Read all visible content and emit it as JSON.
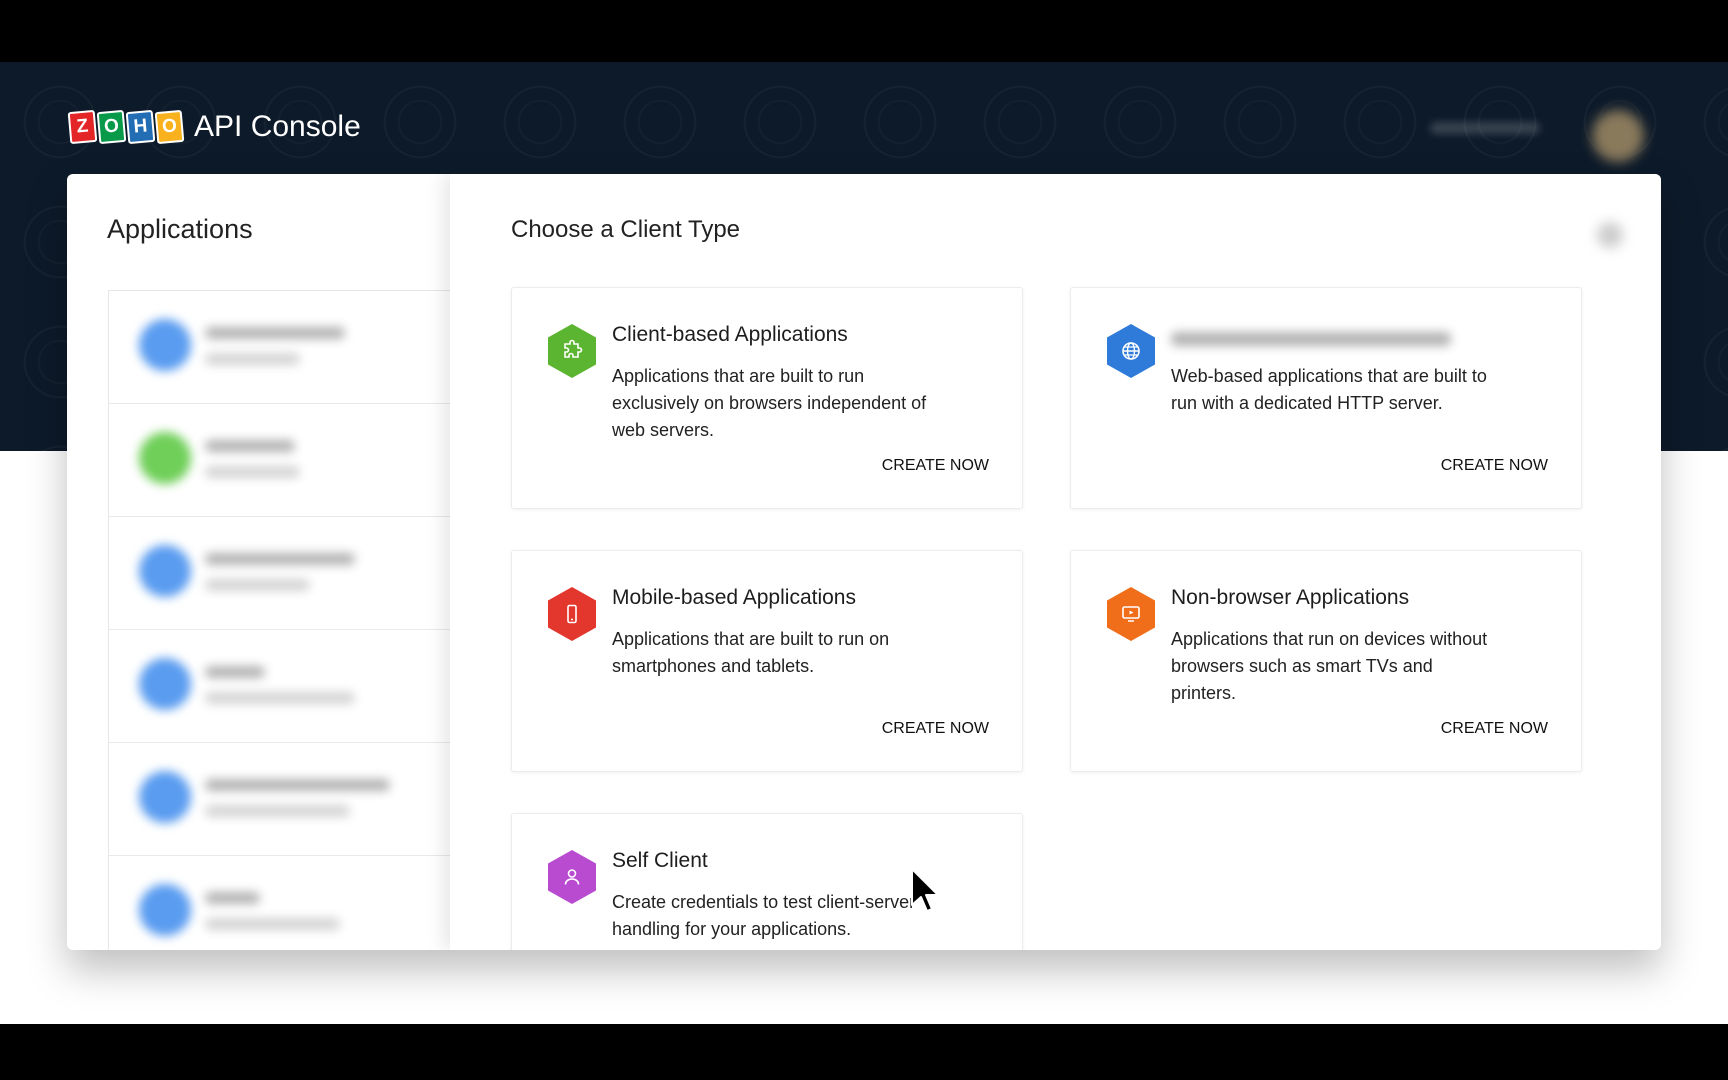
{
  "header": {
    "logo_letters": [
      {
        "char": "Z",
        "color": "#e42527"
      },
      {
        "char": "O",
        "color": "#089949"
      },
      {
        "char": "H",
        "color": "#226db4"
      },
      {
        "char": "O",
        "color": "#f9b21d"
      }
    ],
    "title": "API Console"
  },
  "sidebar": {
    "title": "Applications",
    "items": [
      {
        "icon_color": "#5a9cf0"
      },
      {
        "icon_color": "#6fcf58"
      },
      {
        "icon_color": "#5a9cf0"
      },
      {
        "icon_color": "#5a9cf0"
      },
      {
        "icon_color": "#5a9cf0"
      },
      {
        "icon_color": "#5a9cf0"
      }
    ]
  },
  "modal": {
    "title": "Choose a Client Type",
    "cards": [
      {
        "title": "Client-based Applications",
        "description": "Applications that are built to run exclusively on browsers independent of web servers.",
        "action": "CREATE NOW",
        "icon": "puzzle-icon",
        "color": "#5cb531"
      },
      {
        "title": "",
        "description": "Web-based applications that are built to run with a dedicated HTTP server.",
        "action": "CREATE NOW",
        "icon": "globe-icon",
        "color": "#2f7bd9"
      },
      {
        "title": "Mobile-based Applications",
        "description": "Applications that are built to run on smartphones and tablets.",
        "action": "CREATE NOW",
        "icon": "smartphone-icon",
        "color": "#e3362c"
      },
      {
        "title": "Non-browser Applications",
        "description": "Applications that run on devices without browsers such as smart TVs and printers.",
        "action": "CREATE NOW",
        "icon": "tv-icon",
        "color": "#f06d1a"
      },
      {
        "title": "Self Client",
        "description": "Create credentials to test client-server handling for your applications.",
        "action": "",
        "icon": "user-icon",
        "color": "#b94bd1"
      }
    ]
  }
}
